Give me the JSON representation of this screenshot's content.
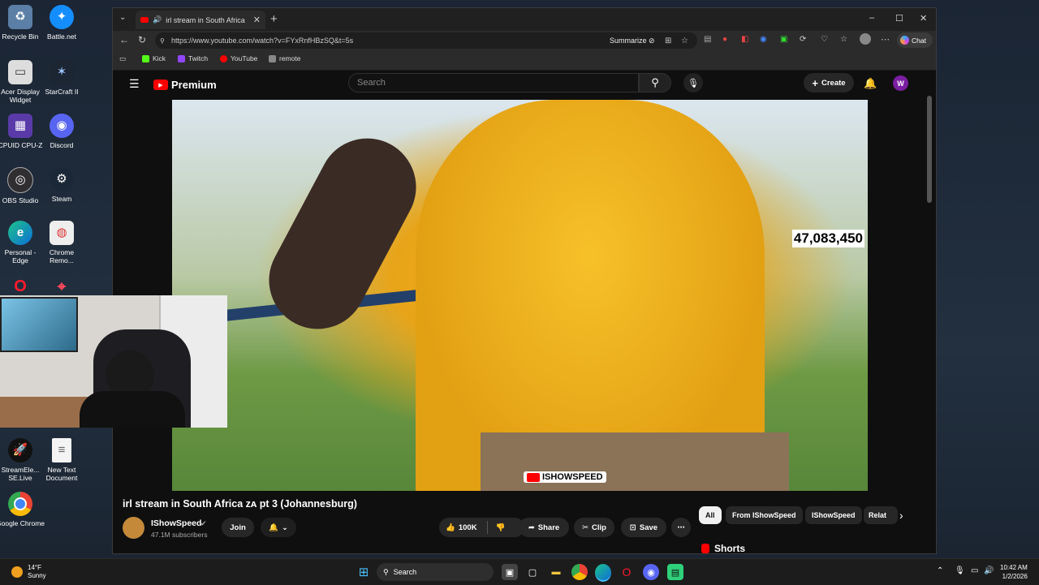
{
  "desktop": {
    "icons": [
      {
        "label": "Recycle Bin"
      },
      {
        "label": "Battle.net"
      },
      {
        "label": "Acer Display Widget"
      },
      {
        "label": "StarCraft II"
      },
      {
        "label": "CPUID CPU-Z"
      },
      {
        "label": "Discord"
      },
      {
        "label": "OBS Studio"
      },
      {
        "label": "Steam"
      },
      {
        "label": "Personal - Edge"
      },
      {
        "label": "Chrome Remo..."
      },
      {
        "label": "StreamEle... SE.Live"
      },
      {
        "label": "New Text Document"
      },
      {
        "label": "Google Chrome"
      }
    ]
  },
  "browser": {
    "tab_title": "irl stream in South Africa ᴢᴀ pt",
    "url": "https://www.youtube.com/watch?v=FYxRnfHBzSQ&t=5s",
    "summarize_label": "Summarize",
    "chat_label": "Chat",
    "favorites": [
      {
        "label": "Kick",
        "color": "#53fc18"
      },
      {
        "label": "Twitch",
        "color": "#9146ff"
      },
      {
        "label": "YouTube",
        "color": "#ff0000"
      },
      {
        "label": "remote",
        "color": "#888888"
      }
    ]
  },
  "youtube": {
    "logo_label": "Premium",
    "search_placeholder": "Search",
    "create_label": "Create",
    "avatar_letter": "W",
    "video": {
      "overlay_counter": "47,083,450",
      "watermark": "ISHOWSPEED",
      "title": "irl stream in South Africa ᴢᴀ pt 3 (Johannesburg)",
      "channel": "IShowSpeed",
      "subscribers": "47.1M subscribers",
      "join_label": "Join",
      "likes": "100K",
      "share_label": "Share",
      "clip_label": "Clip",
      "save_label": "Save"
    },
    "chips": [
      {
        "label": "All"
      },
      {
        "label": "From IShowSpeed"
      },
      {
        "label": "IShowSpeed"
      },
      {
        "label": "Relat"
      }
    ],
    "shorts_label": "Shorts"
  },
  "taskbar": {
    "weather_temp": "14°F",
    "weather_desc": "Sunny",
    "search_label": "Search",
    "time": "10:42 AM",
    "date": "1/2/2026"
  },
  "colors": {
    "yt_red": "#ff0000",
    "chip_active_bg": "#f1f1f1",
    "avatar_bg": "#7b1fa2"
  }
}
